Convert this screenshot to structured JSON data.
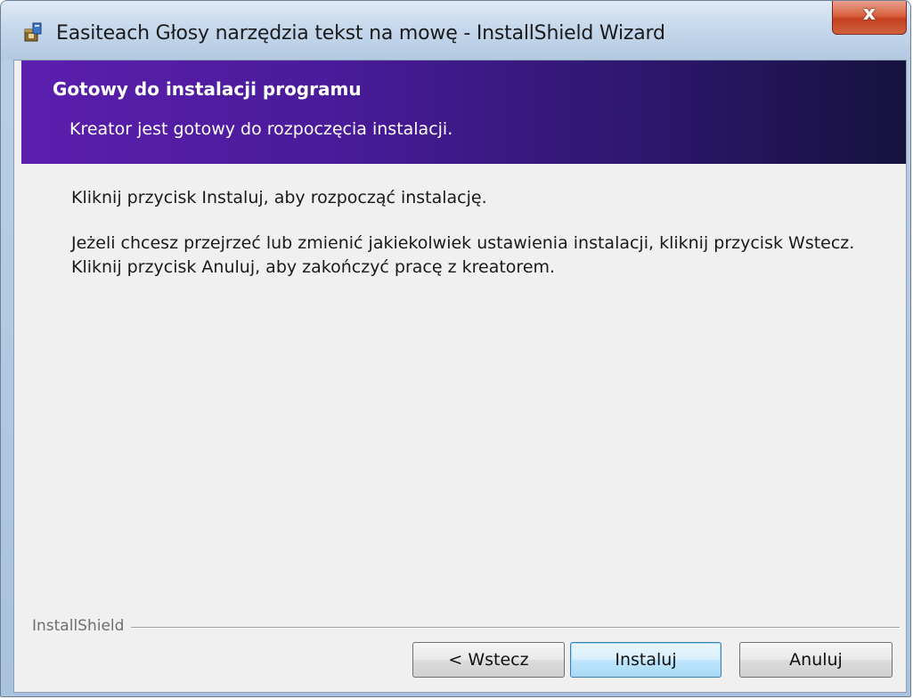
{
  "window": {
    "title": "Easiteach Głosy narzędzia tekst na mowę - InstallShield Wizard",
    "close_label": "x"
  },
  "banner": {
    "title": "Gotowy do instalacji programu",
    "subtitle": "Kreator jest gotowy do rozpoczęcia instalacji."
  },
  "content": {
    "paragraph1": "Kliknij przycisk Instaluj, aby rozpocząć instalację.",
    "paragraph2_line1": "Jeżeli chcesz przejrzeć lub zmienić jakiekolwiek ustawienia instalacji, kliknij przycisk Wstecz.",
    "paragraph2_line2": "Kliknij przycisk Anuluj, aby zakończyć pracę z kreatorem."
  },
  "footer": {
    "brand": "InstallShield",
    "back_label": "< Wstecz",
    "install_label": "Instaluj",
    "cancel_label": "Anuluj"
  },
  "colors": {
    "banner_start": "#5b1fae",
    "banner_end": "#16123e",
    "close_button": "#d9613f",
    "default_button": "#bee6fd"
  },
  "icons": {
    "title_icon": "installer-box-icon",
    "close_icon": "close-icon"
  }
}
